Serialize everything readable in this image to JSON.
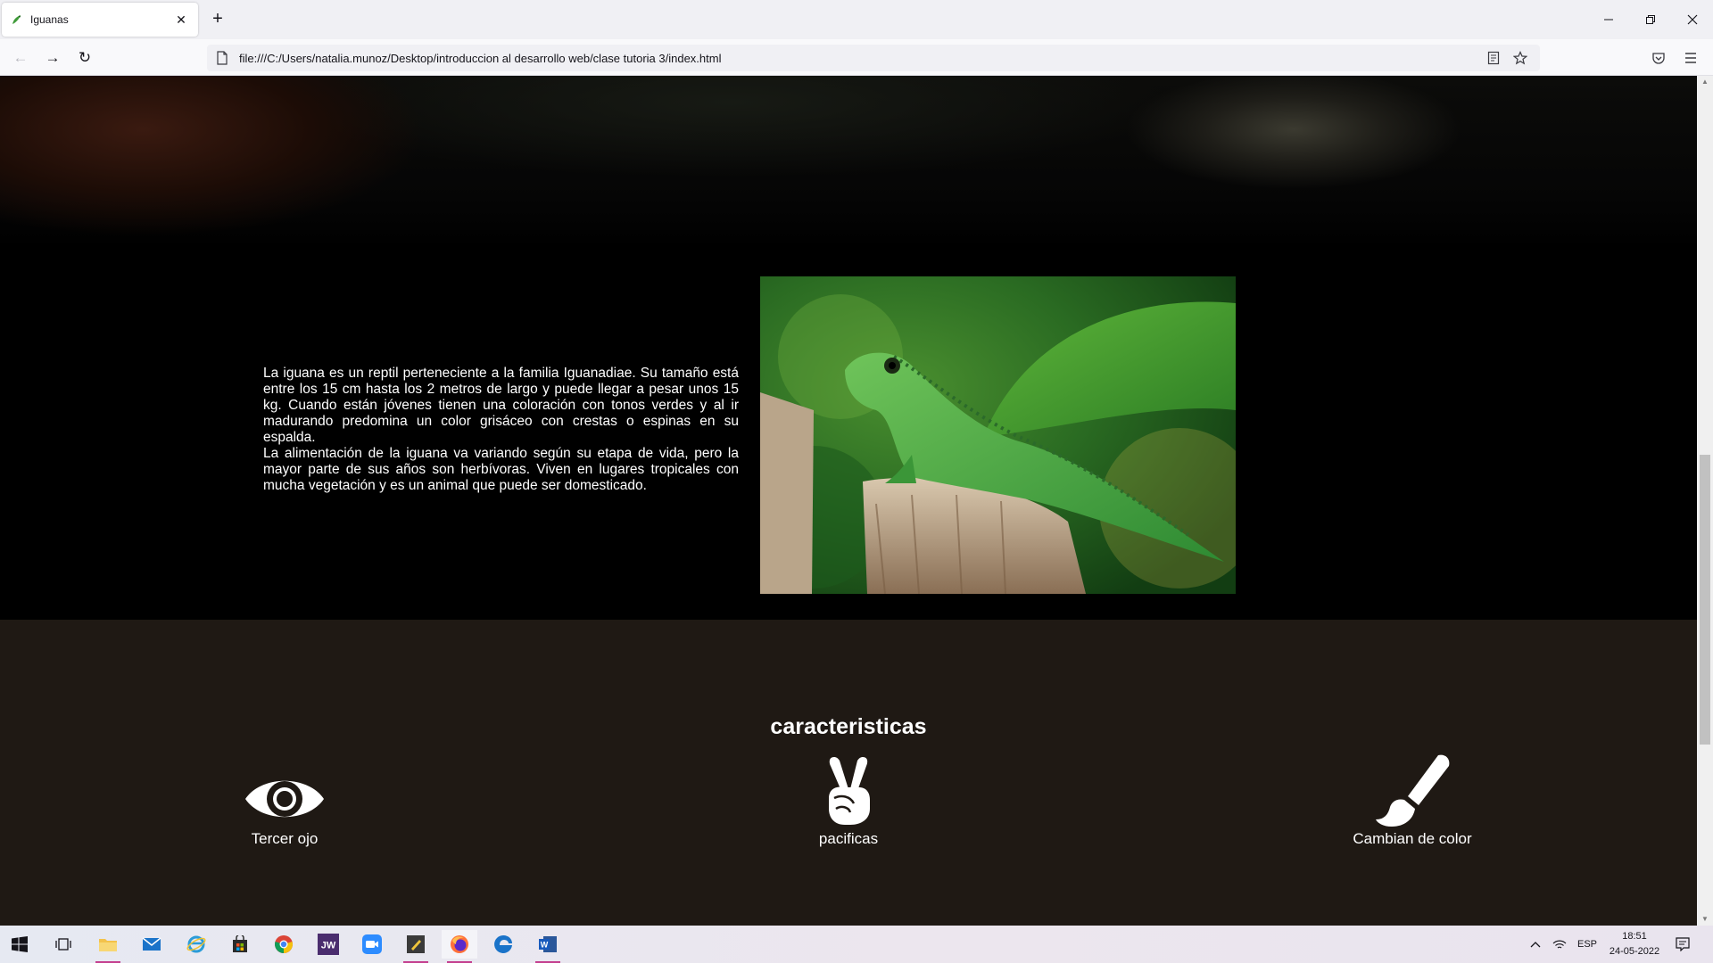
{
  "browser": {
    "tab_title": "Iguanas",
    "tab_close": "✕",
    "new_tab": "+",
    "url": "file:///C:/Users/natalia.munoz/Desktop/introduccion al desarrollo web/clase tutoria 3/index.html",
    "window_controls": {
      "minimize": "—",
      "restore": "❐",
      "close": "✕"
    },
    "nav": {
      "back": "←",
      "forward": "→",
      "reload": "↻"
    }
  },
  "page": {
    "intro": {
      "paragraph_1": "La iguana es un reptil perteneciente a la familia Iguanadiae. Su tamaño está entre los 15 cm hasta los 2 metros de largo y puede llegar a pesar unos 15 kg. Cuando están jóvenes tienen una coloración con tonos verdes y al ir madurando predomina un color grisáceo con crestas o espinas en su espalda.",
      "paragraph_2": "La alimentación de la iguana va variando según su etapa de vida, pero la mayor parte de sus años son herbívoras. Viven en lugares tropicales con mucha vegetación y es un animal que puede ser domesticado."
    },
    "features": {
      "title": "caracteristicas",
      "items": [
        {
          "icon": "eye-icon",
          "label": "Tercer ojo"
        },
        {
          "icon": "peace-hand-icon",
          "label": "pacificas"
        },
        {
          "icon": "paintbrush-icon",
          "label": "Cambian de color"
        }
      ]
    }
  },
  "taskbar": {
    "language": "ESP",
    "time": "18:51",
    "date": "24-05-2022",
    "apps": [
      "windows-start-icon",
      "task-view-icon",
      "file-explorer-icon",
      "mail-icon",
      "internet-explorer-icon",
      "store-icon",
      "chrome-icon",
      "jw-icon",
      "zoom-icon",
      "notes-icon",
      "firefox-icon",
      "edge-icon",
      "word-icon"
    ]
  },
  "colors": {
    "features_bg": "#1f1914",
    "page_bg": "#000000",
    "iguana_green": "#3f9b3a",
    "taskbar_accent": "#c43f8f"
  }
}
